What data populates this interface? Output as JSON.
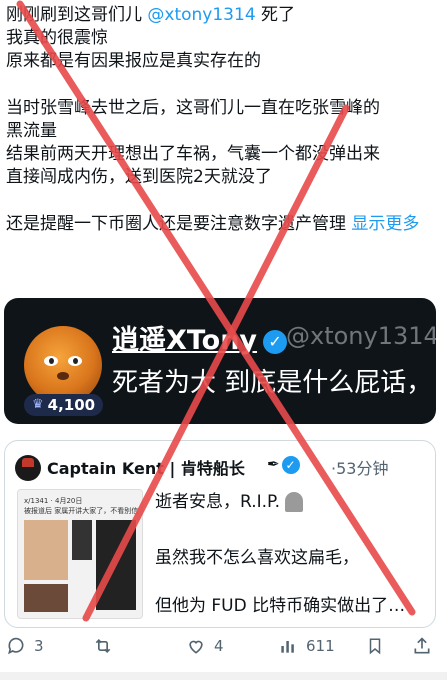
{
  "post": {
    "line1_pre": "刚刚刷到这哥们儿 ",
    "line1_mention": "@xtony1314",
    "line1_post": " 死了",
    "line2": "我真的很震惊",
    "line3": "原来都是有因果报应是真实存在的",
    "line4": "当时张雪峰去世之后，这哥们儿一直在吃张雪峰的",
    "line5": "黑流量",
    "line6": "结果前两天开理想出了车祸，气囊一个都没弹出来",
    "line7": "直接闯成内伤，送到医院2天就没了",
    "line8": "还是提醒一下币圈人还是要注意数字遗产管理 ",
    "show_more": "显示更多"
  },
  "profile_card": {
    "name": "逍遥XTony",
    "handle": "@xtony1314",
    "quote": "死者为大 到底是什么屁话，",
    "badge_count": "4,100"
  },
  "quote_card": {
    "name": "Captain Kent | 肯特船长",
    "time": "·53分钟",
    "line1": "逝者安息，R.I.P.",
    "line2": "虽然我不怎么喜欢这扁毛，",
    "line3": "但他为 FUD 比特币确实做出了…",
    "thumb_text1": "x/1341 · 4月20日",
    "thumb_text2": "被报道后 家属开讲大家了，不看别信"
  },
  "actions": {
    "replies": "3",
    "retweets": "",
    "likes": "4",
    "views": "611"
  },
  "colors": {
    "accent": "#1d9bf0",
    "cross": "#e84a4a",
    "muted": "#536471"
  }
}
